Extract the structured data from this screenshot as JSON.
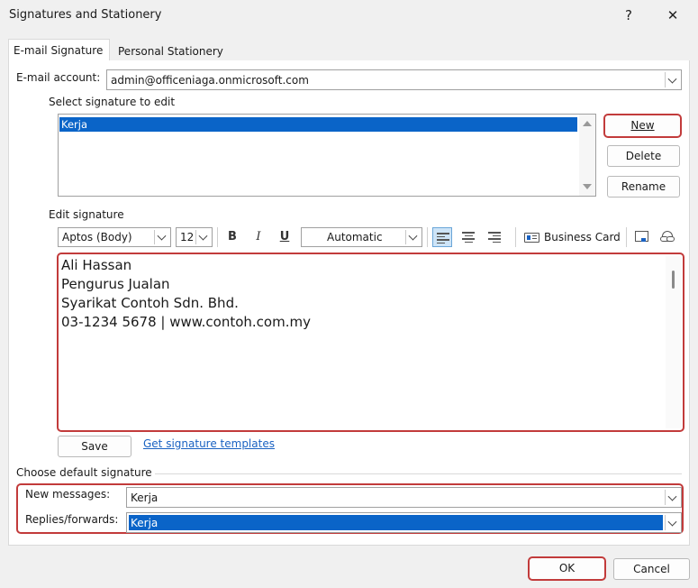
{
  "window": {
    "title": "Signatures and Stationery",
    "help_label": "?",
    "close_label": "✕"
  },
  "tabs": [
    {
      "label": "E-mail Signature",
      "active": true
    },
    {
      "label": "Personal Stationery",
      "active": false
    }
  ],
  "account": {
    "label": "E-mail account:",
    "value": "admin@officeniaga.onmicrosoft.com"
  },
  "select_signature": {
    "label": "Select signature to edit",
    "items": [
      {
        "label": "Kerja",
        "selected": true
      }
    ]
  },
  "buttons": {
    "new": "New",
    "delete": "Delete",
    "rename": "Rename",
    "save": "Save",
    "ok": "OK",
    "cancel": "Cancel"
  },
  "edit_signature": {
    "label": "Edit signature",
    "font": "Aptos (Body)",
    "size": "12",
    "bold": "B",
    "italic": "I",
    "underline": "U",
    "color": "Automatic",
    "business_card": "Business Card"
  },
  "signature_lines": [
    "Ali Hassan",
    "Pengurus Jualan",
    "Syarikat Contoh Sdn. Bhd.",
    "03-1234 5678 | www.contoh.com.my"
  ],
  "templates_link": "Get signature templates",
  "default_signature": {
    "label": "Choose default signature",
    "new_messages": {
      "label": "New messages:",
      "value": "Kerja"
    },
    "replies": {
      "label": "Replies/forwards:",
      "value": "Kerja"
    }
  },
  "colors": {
    "highlight": "#c23b3b",
    "selection": "#0a64c8",
    "link": "#1a62c2"
  }
}
